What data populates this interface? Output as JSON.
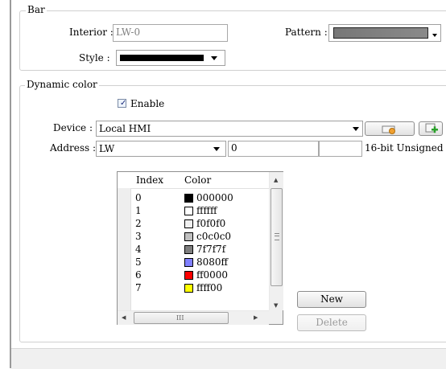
{
  "bar": {
    "legend": "Bar",
    "interior_label": "Interior :",
    "interior_value": "LW-0",
    "pattern_label": "Pattern :",
    "style_label": "Style :",
    "style_color": "#000000",
    "pattern_color": "#808080"
  },
  "dynamic": {
    "legend": "Dynamic color",
    "enable_label": "Enable",
    "enable_checked": true,
    "device_label": "Device :",
    "device_value": "Local HMI",
    "address_label": "Address :",
    "address_type": "LW",
    "address_value": "0",
    "address_extra": "",
    "format": "16-bit Unsigned",
    "setting_icon": "settings-icon",
    "add_icon": "add-icon"
  },
  "table": {
    "headers": [
      "Index",
      "Color"
    ],
    "rows": [
      {
        "index": "0",
        "hex": "000000",
        "color": "#000000"
      },
      {
        "index": "1",
        "hex": "ffffff",
        "color": "#ffffff"
      },
      {
        "index": "2",
        "hex": "f0f0f0",
        "color": "#f0f0f0"
      },
      {
        "index": "3",
        "hex": "c0c0c0",
        "color": "#c0c0c0"
      },
      {
        "index": "4",
        "hex": "7f7f7f",
        "color": "#7f7f7f"
      },
      {
        "index": "5",
        "hex": "8080ff",
        "color": "#8080ff"
      },
      {
        "index": "6",
        "hex": "ff0000",
        "color": "#ff0000"
      },
      {
        "index": "7",
        "hex": "ffff00",
        "color": "#ffff00"
      }
    ],
    "hscroll_grip": "III"
  },
  "buttons": {
    "new_label": "New",
    "delete_label": "Delete"
  }
}
